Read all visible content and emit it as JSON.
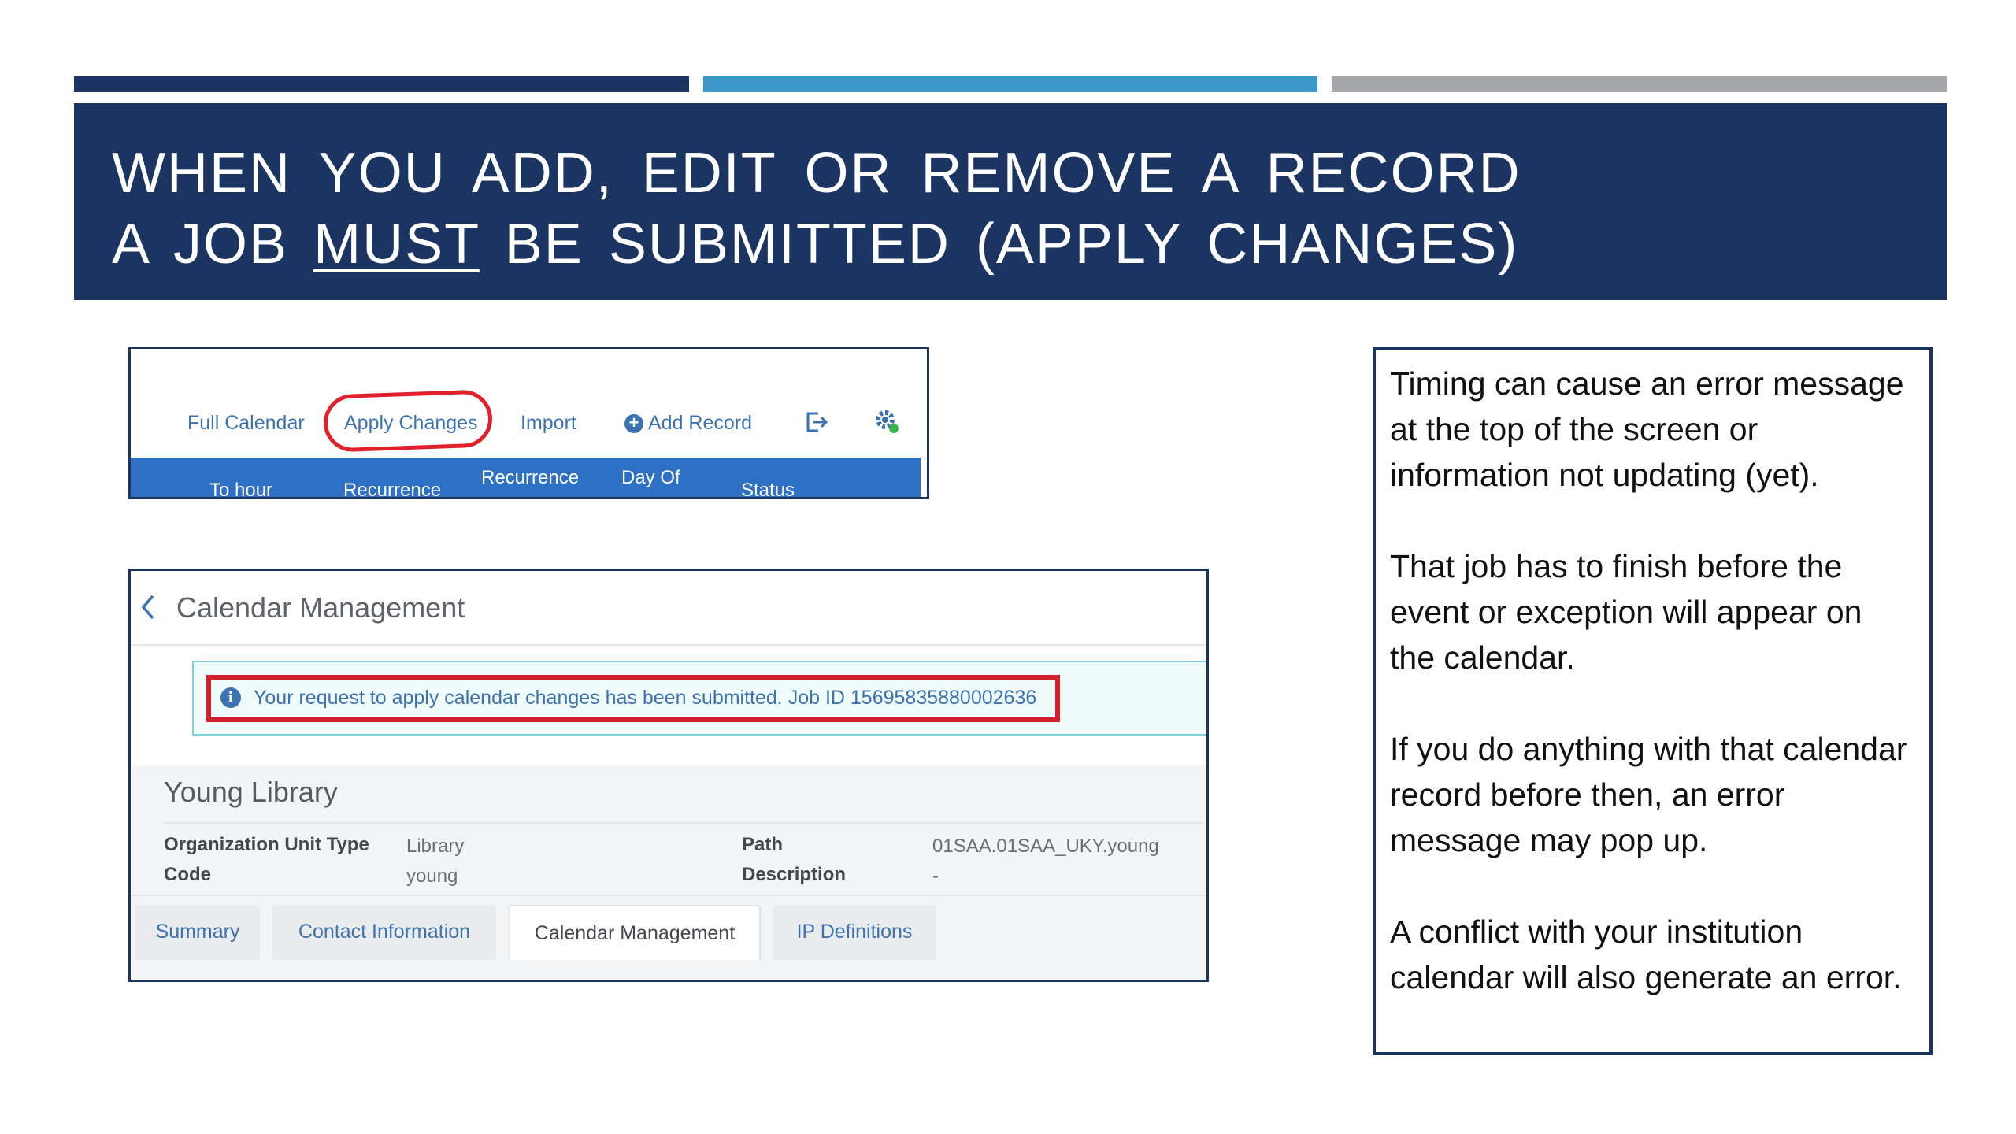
{
  "slide": {
    "title_line1": "WHEN YOU ADD, EDIT  OR  REMOVE A  RECORD",
    "title_line2_prefix": "A  JOB ",
    "title_line2_emphasis": "MUST",
    "title_line2_suffix": " BE SUBMITTED (APPLY CHANGES)",
    "bar_colors": [
      "#1b3461",
      "#3a97c9",
      "#a5a7aa"
    ]
  },
  "toolbar": {
    "full_calendar": "Full Calendar",
    "apply_changes": "Apply Changes",
    "import": "Import",
    "add_record": "Add Record",
    "export_icon": "export-icon",
    "gear_icon": "gear-icon",
    "highlight_color": "#e0202a",
    "columns": [
      "To hour",
      "Recurrence",
      "Recurrence",
      "Day Of",
      "Status"
    ]
  },
  "calendar": {
    "title": "Calendar Management",
    "alert_text": "Your request to apply calendar changes has been submitted. Job ID 15695835880002636",
    "org_name": "Young Library",
    "fields": {
      "org_unit_type_label": "Organization Unit Type",
      "org_unit_type_value": "Library",
      "code_label": "Code",
      "code_value": "young",
      "path_label": "Path",
      "path_value": "01SAA.01SAA_UKY.young",
      "description_label": "Description",
      "description_value": "-"
    },
    "tabs": [
      "Summary",
      "Contact Information",
      "Calendar Management",
      "IP Definitions"
    ],
    "active_tab": "Calendar Management"
  },
  "notes": [
    "Timing can cause an error message at the top of the screen or information not updating (yet).",
    "That job has to finish before the event or exception will appear on the calendar.",
    "If you do anything with that calendar record before then, an error message may pop up.",
    "A conflict with your institution calendar will also generate an error."
  ]
}
